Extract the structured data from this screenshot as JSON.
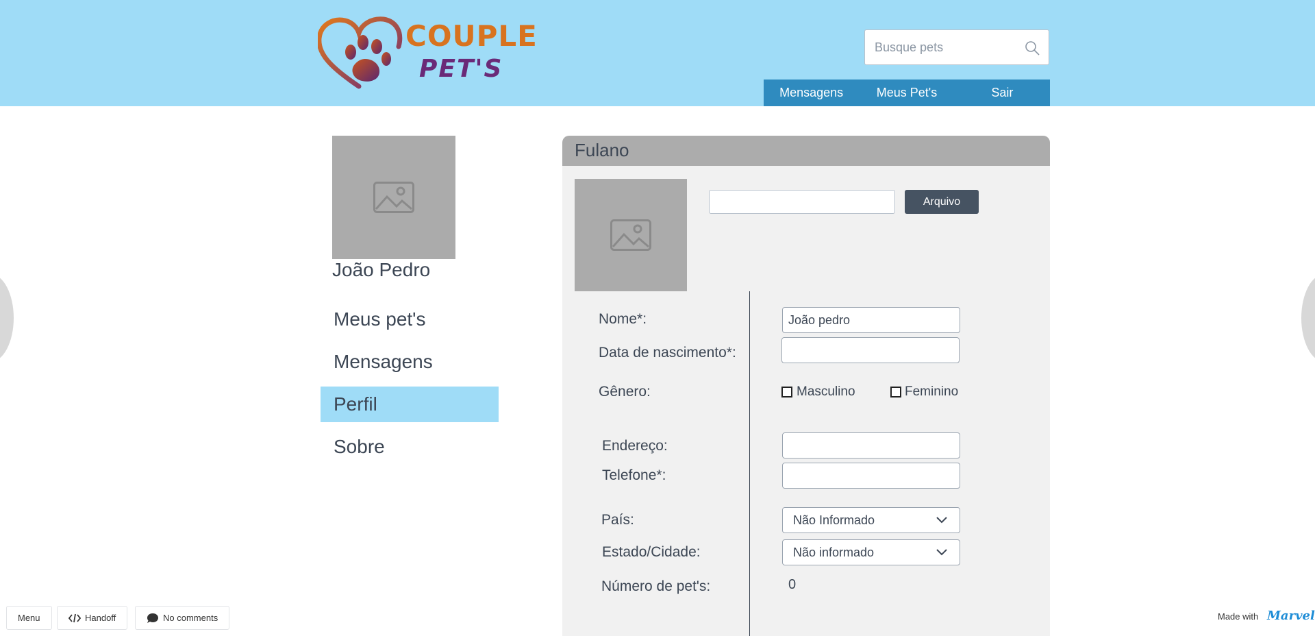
{
  "brand": {
    "line1": "COUPLE",
    "line2": "PET'S"
  },
  "search": {
    "placeholder": "Busque pets"
  },
  "topnav": {
    "items": [
      "Mensagens",
      "Meus Pet's",
      "Sair"
    ]
  },
  "profile": {
    "name": "João Pedro"
  },
  "sidebar": {
    "items": [
      {
        "label": "Meus pet's",
        "active": false
      },
      {
        "label": "Mensagens",
        "active": false
      },
      {
        "label": "Perfil",
        "active": true
      },
      {
        "label": "Sobre",
        "active": false
      }
    ]
  },
  "panel": {
    "title": "Fulano",
    "file_value": "",
    "file_button": "Arquivo"
  },
  "form": {
    "nome_label": "Nome*:",
    "nome_value": "João pedro",
    "nascimento_label": "Data de nascimento*:",
    "nascimento_value": "",
    "genero_label": "Gênero:",
    "genero_options": [
      "Masculino",
      "Feminino"
    ],
    "endereco_label": "Endereço:",
    "endereco_value": "",
    "telefone_label": "Telefone*:",
    "telefone_value": "",
    "pais_label": "País:",
    "pais_value": "Não Informado",
    "estado_label": "Estado/Cidade:",
    "estado_value": "Não informado",
    "pets_label": "Número de pet's:",
    "pets_value": "0"
  },
  "footer": {
    "menu": "Menu",
    "handoff": "Handoff",
    "comments": "No comments",
    "made_with": "Made with",
    "marvel": "Marvel"
  },
  "colors": {
    "header_bg": "#9fdcf7",
    "nav_bg": "#2f8bbf",
    "active_item": "#9fdcf7",
    "button_dark": "#465362",
    "placeholder_gray": "#ababab"
  }
}
